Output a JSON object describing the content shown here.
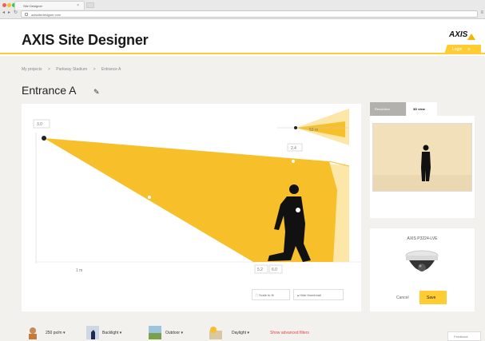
{
  "browser": {
    "tab_title": "Site Designer",
    "url": "axissitedesigner.com"
  },
  "header": {
    "app_title": "AXIS Site Designer",
    "logo_text": "AXIS",
    "login_label": "Login"
  },
  "breadcrumb": [
    "My projects",
    ">",
    "Parkway Stadium",
    ">",
    "Entrance A"
  ],
  "page": {
    "title": "Entrance A"
  },
  "diagram": {
    "height_label": "3.0",
    "top_dim_label": "2.4",
    "inset_label": "53 m",
    "dist_label_1": "5.2",
    "dist_label_2": "6.0",
    "scale_label": "1 m",
    "scale_to_fit_label": "Scale to fit",
    "hide_thumbnail_label": "Hide thumbnail"
  },
  "view_tabs": {
    "resolution": "Resolution",
    "view_3d": "3D view"
  },
  "product": {
    "model_name": "AXIS P3224-LVE",
    "cancel_label": "Cancel",
    "save_label": "Save"
  },
  "bottom_bar": {
    "resolution_value": "250 px/m",
    "backlight_label": "Backlight",
    "outdoor_label": "Outdoor",
    "daylight_label": "Daylight",
    "advanced_filters_label": "Show advanced filters",
    "feedback_label": "Feedback"
  },
  "icons": {
    "accent_color": "#ffcc33",
    "fov_color": "#f7c02a",
    "fov_light_color": "#fde7a8",
    "person_color": "#111111"
  }
}
